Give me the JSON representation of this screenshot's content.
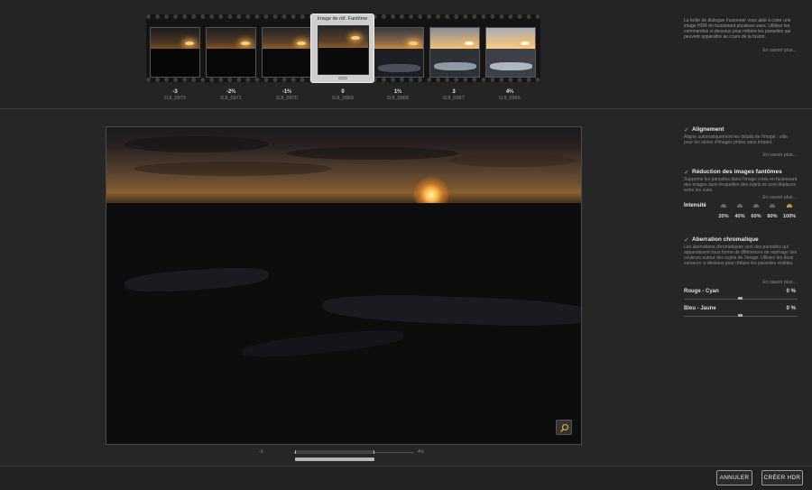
{
  "filmstrip": {
    "reference_label": "Image de réf. Fantôme",
    "frames": [
      {
        "ev": "-3",
        "file": "DJI_0973",
        "kind": "dark"
      },
      {
        "ev": "-2⅔",
        "file": "DJI_0971",
        "kind": "dark"
      },
      {
        "ev": "-1⅔",
        "file": "DJI_0970",
        "kind": "dark"
      },
      {
        "ev": "0",
        "file": "DJI_0969",
        "kind": "ref"
      },
      {
        "ev": "1⅔",
        "file": "DJI_0968",
        "kind": "mid"
      },
      {
        "ev": "3",
        "file": "DJI_0967",
        "kind": "bright"
      },
      {
        "ev": "4⅔",
        "file": "DJI_0966",
        "kind": "bright"
      }
    ]
  },
  "info": {
    "text": "La boîte de dialogue Fusionner vous aide à créer une image HDR en fusionnant plusieurs vues. Utilisez les commandes ci-dessous pour réduire les parasites qui peuvent apparaître au cours de la fusion.",
    "learn_more": "En savoir plus..."
  },
  "alignment": {
    "title": "Alignement",
    "description": "Aligne automatiquement les détails de l'image ; utile pour les séries d'images prises sans trépied.",
    "learn_more": "En savoir plus..."
  },
  "ghost_reduction": {
    "title": "Réduction des images fantômes",
    "description": "Supprime les parasites dans l'image créés en fusionnant des images dans lesquelles des sujets se sont déplacés entre les vues.",
    "learn_more": "En savoir plus...",
    "intensity_label": "Intensité",
    "options": [
      "20%",
      "40%",
      "60%",
      "80%",
      "100%"
    ],
    "selected": "100%"
  },
  "chromatic_aberration": {
    "title": "Aberration chromatique",
    "description": "Les aberrations chromatiques sont des parasites qui apparaissent sous forme de différences de repérage des couleurs autour des sujets de l'image. Utilisez les deux curseurs ci-dessous pour réduire les parasites visibles.",
    "learn_more": "En savoir plus...",
    "red_cyan_label": "Rouge - Cyan",
    "red_cyan_value": "0 %",
    "blue_yellow_label": "Bleu - Jaune",
    "blue_yellow_value": "0 %"
  },
  "exposure_slider": {
    "min_label": "-3",
    "max_label": "4⅔"
  },
  "buttons": {
    "cancel": "ANNULER",
    "create": "CRÉER HDR"
  },
  "colors": {
    "accent": "#c8952f",
    "background": "#262626"
  }
}
